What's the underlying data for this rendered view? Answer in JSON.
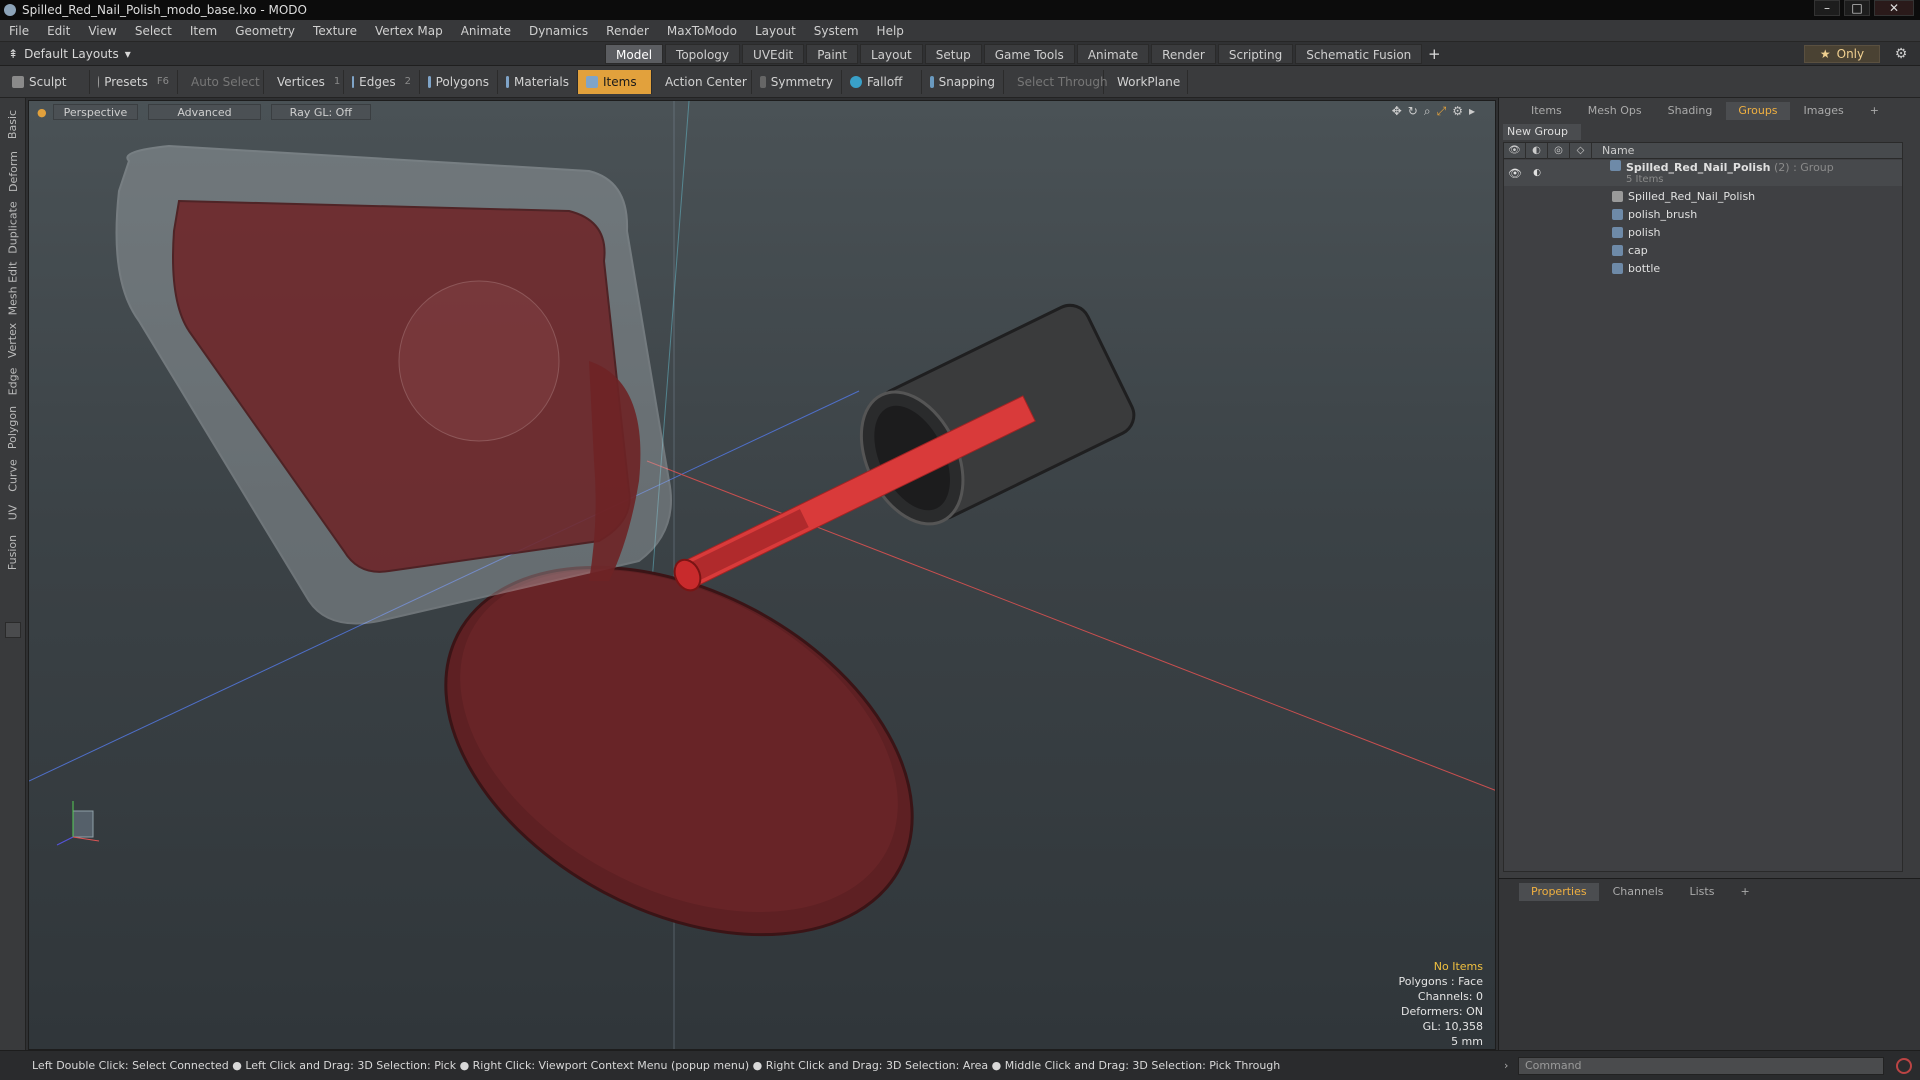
{
  "window": {
    "title": "Spilled_Red_Nail_Polish_modo_base.lxo - MODO",
    "min": "–",
    "max": "□",
    "close": "✕"
  },
  "menu": [
    "File",
    "Edit",
    "View",
    "Select",
    "Item",
    "Geometry",
    "Texture",
    "Vertex Map",
    "Animate",
    "Dynamics",
    "Render",
    "MaxToModo",
    "Layout",
    "System",
    "Help"
  ],
  "layout_select": "Default Layouts",
  "mode_tabs": [
    "Model",
    "Topology",
    "UVEdit",
    "Paint",
    "Layout",
    "Setup",
    "Game Tools",
    "Animate",
    "Render",
    "Scripting",
    "Schematic Fusion"
  ],
  "active_mode_tab": "Model",
  "only_label": "Only",
  "toolbar": {
    "sculpt": "Sculpt",
    "presets": "Presets",
    "presets_key": "F6",
    "auto_select": "Auto Select",
    "vertices": "Vertices",
    "vertices_key": "1",
    "edges": "Edges",
    "edges_key": "2",
    "polygons": "Polygons",
    "materials": "Materials",
    "items": "Items",
    "action_center": "Action Center",
    "symmetry": "Symmetry",
    "falloff": "Falloff",
    "snapping": "Snapping",
    "select_through": "Select Through",
    "workplane": "WorkPlane"
  },
  "left_tabs": [
    "Basic",
    "Deform",
    "Duplicate",
    "Mesh Edit",
    "Vertex",
    "Edge",
    "Polygon",
    "Curve",
    "UV",
    "Fusion"
  ],
  "viewport": {
    "view": "Perspective",
    "shading": "Advanced",
    "raygl": "Ray GL: Off",
    "info": {
      "no_items": "No Items",
      "polygons": "Polygons : Face",
      "channels": "Channels: 0",
      "deformers": "Deformers: ON",
      "gl": "GL: 10,358",
      "units": "5 mm"
    }
  },
  "status_bar": "Left Double Click: Select Connected ● Left Click and Drag: 3D Selection: Pick ● Right Click: Viewport Context Menu (popup menu) ● Right Click and Drag: 3D Selection: Area ● Middle Click and Drag: 3D Selection: Pick Through",
  "right_panel": {
    "tabs": [
      "Items",
      "Mesh Ops",
      "Shading",
      "Groups",
      "Images"
    ],
    "active_tab": "Groups",
    "new_group": "New Group",
    "name_header": "Name",
    "group": {
      "name": "Spilled_Red_Nail_Polish",
      "count": "(2)",
      "type": ": Group",
      "sub": "5 Items"
    },
    "items": [
      "Spilled_Red_Nail_Polish",
      "polish_brush",
      "polish",
      "cap",
      "bottle"
    ]
  },
  "bottom_panel": {
    "tabs": [
      "Properties",
      "Channels",
      "Lists"
    ],
    "active_tab": "Properties"
  },
  "command_placeholder": "Command",
  "colors": {
    "accent": "#e2a13c",
    "polish": "#8a2a2e",
    "brush": "#d93a3a"
  }
}
